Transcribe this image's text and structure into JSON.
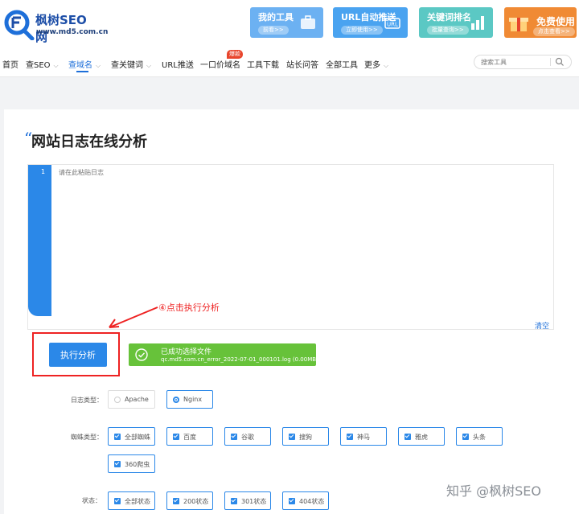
{
  "brand": {
    "title": "枫树SEO网",
    "url": "www.md5.com.cn"
  },
  "banners": [
    {
      "title": "我的工具",
      "pill": "前看>>",
      "color": "#6cb1f2"
    },
    {
      "title": "URL自动推送",
      "pill": "立即使用>>",
      "color": "#4aa3f0"
    },
    {
      "title": "关键词排名",
      "pill": "批量查询>>",
      "color": "#5bc8c4"
    },
    {
      "title": "免费使用",
      "pill": "点击查看>>",
      "color": "#f08a34"
    }
  ],
  "nav": {
    "items": [
      {
        "label": "首页"
      },
      {
        "label": "查SEO"
      },
      {
        "label": "查域名"
      },
      {
        "label": "查关键词"
      },
      {
        "label": "URL推送"
      },
      {
        "label": "一口价域名"
      },
      {
        "label": "工具下载"
      },
      {
        "label": "站长问答"
      },
      {
        "label": "全部工具"
      },
      {
        "label": "更多"
      }
    ],
    "active_index": 2,
    "hot_badge": "爆款",
    "search_placeholder": "搜索工具"
  },
  "page": {
    "title": "网站日志在线分析",
    "quote_mark": "“",
    "editor": {
      "line_number": "1",
      "placeholder": "请在此粘贴日志"
    },
    "clear_label": "清空",
    "annotation": "④点击执行分析",
    "execute_label": "执行分析",
    "file_status": {
      "title": "已成功选择文件",
      "filename": "qc.md5.com.cn_error_2022-07-01_000101.log (0.00MB)"
    }
  },
  "filters": {
    "log_type": {
      "label": "日志类型：",
      "options": [
        {
          "label": "Apache",
          "selected": false
        },
        {
          "label": "Nginx",
          "selected": true
        }
      ]
    },
    "spider_type": {
      "label": "蜘蛛类型：",
      "options": [
        "全部蜘蛛",
        "百度",
        "谷歌",
        "搜狗",
        "神马",
        "雅虎",
        "头条",
        "360爬虫"
      ]
    },
    "status": {
      "label": "状态：",
      "options": [
        "全部状态",
        "200状态",
        "301状态",
        "404状态"
      ]
    }
  },
  "watermark": "知乎 @枫树SEO",
  "colors": {
    "primary": "#2b88e8",
    "success": "#67c23a",
    "annotation": "#e22222",
    "hot": "#e8452c"
  }
}
